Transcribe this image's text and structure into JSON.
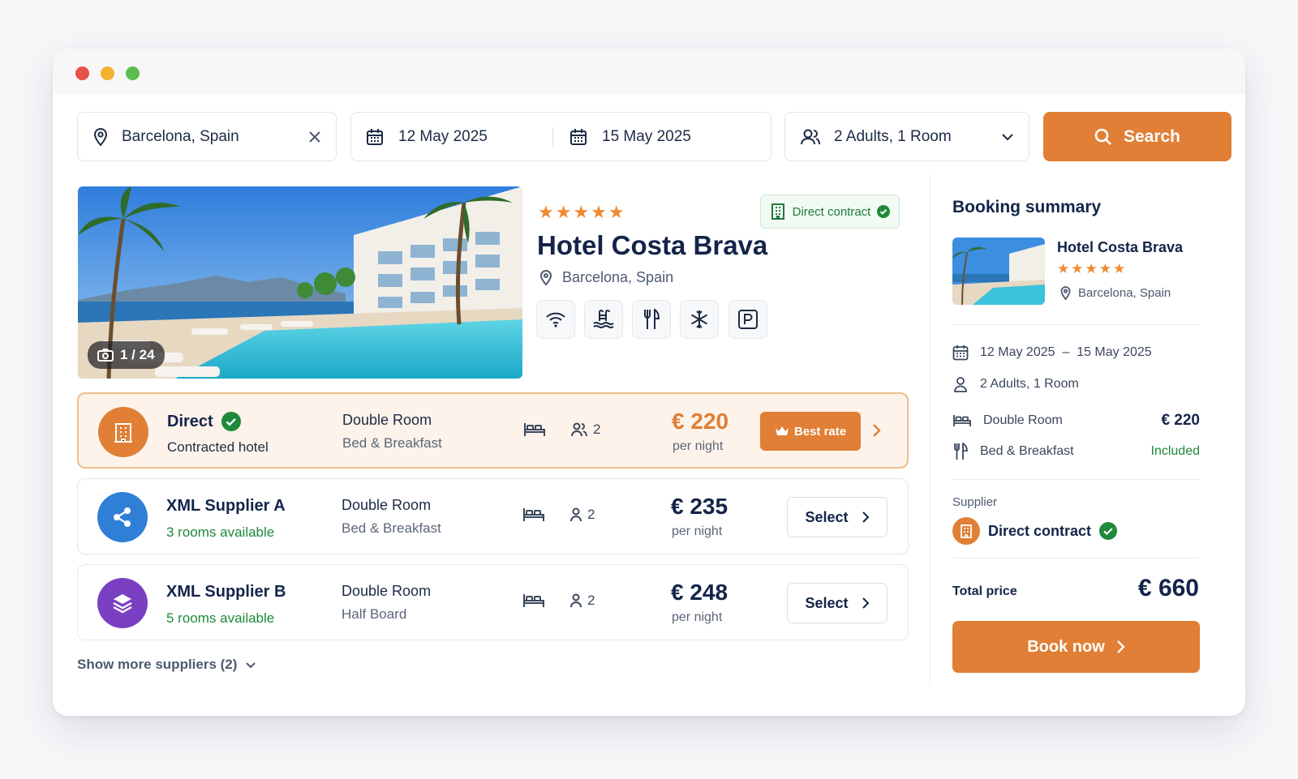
{
  "search": {
    "location": "Barcelona, Spain",
    "check_in": "12 May 2025",
    "check_out": "15 May 2025",
    "guests": "2 Adults, 1 Room",
    "button_label": "Search"
  },
  "hotel": {
    "name": "Hotel Costa Brava",
    "stars": "★★★★★",
    "star_rating": 5,
    "location": "Barcelona, Spain",
    "badge": "Direct contract",
    "photo_counter": "1 / 24",
    "amenities": [
      "wifi-icon",
      "pool-icon",
      "restaurant-icon",
      "air-conditioning-icon",
      "parking-icon"
    ]
  },
  "suppliers": [
    {
      "name": "Direct",
      "sub": "Contracted hotel",
      "room": "Double Room",
      "board": "Bed & Breakfast",
      "capacity": "2",
      "price": "€ 220",
      "per": "per night",
      "action": "Best rate",
      "verified": true
    },
    {
      "name": "XML Supplier A",
      "sub": "3 rooms available",
      "room": "Double Room",
      "board": "Bed & Breakfast",
      "capacity": "2",
      "price": "€ 235",
      "per": "per night",
      "action": "Select"
    },
    {
      "name": "XML Supplier B",
      "sub": "5 rooms available",
      "room": "Double Room",
      "board": "Half Board",
      "capacity": "2",
      "price": "€ 248",
      "per": "per night",
      "action": "Select"
    }
  ],
  "show_more": "Show more suppliers (2)",
  "summary": {
    "title": "Booking summary",
    "hotel_name": "Hotel Costa Brava",
    "stars": "★★★★★",
    "location": "Barcelona, Spain",
    "dates": "12 May 2025  –  15 May 2025",
    "guests": "2 Adults, 1 Room",
    "room": "Double Room",
    "room_price": "€ 220",
    "board": "Bed & Breakfast",
    "board_value": "Included",
    "supplier_label": "Supplier",
    "supplier": "Direct contract",
    "total_label": "Total price",
    "total": "€ 660",
    "book_label": "Book now"
  },
  "colors": {
    "accent": "#e07f35",
    "navy": "#14244a",
    "green": "#1f8a3a",
    "blue": "#2f7fd6",
    "purple": "#7b3fc4"
  }
}
